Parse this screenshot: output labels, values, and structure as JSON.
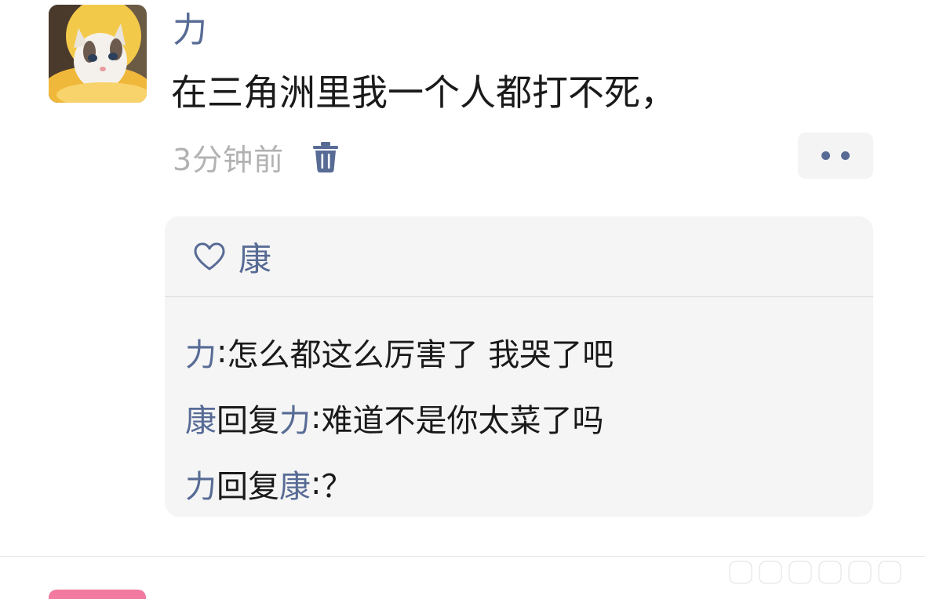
{
  "post": {
    "author": "力",
    "avatar_icon": "cat-photo-avatar",
    "text": "在三角洲里我一个人都打不死，",
    "timestamp": "3分钟前",
    "delete_icon": "trash-icon",
    "more_icon": "more-dots-icon"
  },
  "interactions": {
    "like_icon": "heart-outline-icon",
    "likes": [
      "康"
    ],
    "comments": [
      {
        "from": "力",
        "reply_word": "",
        "to": "",
        "sep": ": ",
        "text": "怎么都这么厉害了 我哭了吧"
      },
      {
        "from": "康",
        "reply_word": "回复",
        "to": "力",
        "sep": ": ",
        "text": "难道不是你太菜了吗"
      },
      {
        "from": "力",
        "reply_word": "回复",
        "to": "康",
        "sep": ": ",
        "text": "？"
      }
    ]
  },
  "colors": {
    "link": "#576b95",
    "text": "#1a1a1a",
    "muted": "#b2b2b2",
    "panel_bg": "#f5f5f5"
  }
}
